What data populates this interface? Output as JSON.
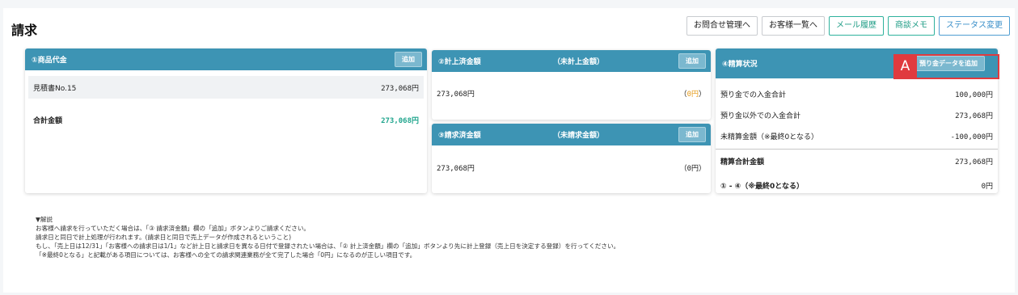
{
  "page": {
    "title": "請求"
  },
  "top_buttons": [
    {
      "label": "お問合せ管理へ"
    },
    {
      "label": "お客様一覧へ"
    },
    {
      "label": "メール履歴"
    },
    {
      "label": "商談メモ"
    },
    {
      "label": "ステータス変更"
    }
  ],
  "panel1": {
    "title": "①商品代金",
    "add_label": "追加",
    "row_label": "見積書No.15",
    "row_amount": "273,068円",
    "total_label": "合計金額",
    "total_amount": "273,068円"
  },
  "panel2": {
    "title": "②計上済金額",
    "subtitle": "（未計上金額）",
    "add_label": "追加",
    "amount": "273,068円",
    "open_paren": "（",
    "sub_amount": "0円",
    "close_paren": "）"
  },
  "panel3": {
    "title": "③請求済金額",
    "subtitle": "（未請求金額）",
    "add_label": "追加",
    "amount": "273,068円",
    "sub_amount": "（0円）"
  },
  "panel4": {
    "title": "④精算状況",
    "add_label": "預り金データを追加",
    "rows": [
      {
        "label": "預り金での入金合計",
        "amount": "100,000円"
      },
      {
        "label": "預り金以外での入金合計",
        "amount": "273,068円"
      },
      {
        "label": "未精算金額（※最終0となる）",
        "amount": "-100,000円"
      }
    ],
    "total_label": "精算合計金額",
    "total_amount": "273,068円",
    "final_label": "① - ④（※最終0となる）",
    "final_amount": "0円"
  },
  "notes": {
    "heading": "▼解説",
    "lines": [
      "お客様へ請求を行っていただく場合は、「③ 請求済金額」欄の「追加」ボタンよりご請求ください。",
      "請求日と同日で計上処理が行われます。(請求日と同日で売上データが作成されるということ)",
      "もし、「売上日は12/31」「お客様への請求日は1/1」など計上日と請求日を異なる日付で登録されたい場合は、「② 計上済金額」欄の「追加」ボタンより先に計上登録（売上日を決定する登録）を行ってください。",
      "「※最終0となる」と記載がある項目については、お客様への全ての請求関連業務が全て完了した場合「0円」になるのが正しい項目です。"
    ]
  },
  "annotation": {
    "label": "A",
    "color": "#e03a3e"
  },
  "colors": {
    "header": "#3d94b4",
    "accent_teal": "#20a58d",
    "accent_orange": "#e69b19"
  }
}
